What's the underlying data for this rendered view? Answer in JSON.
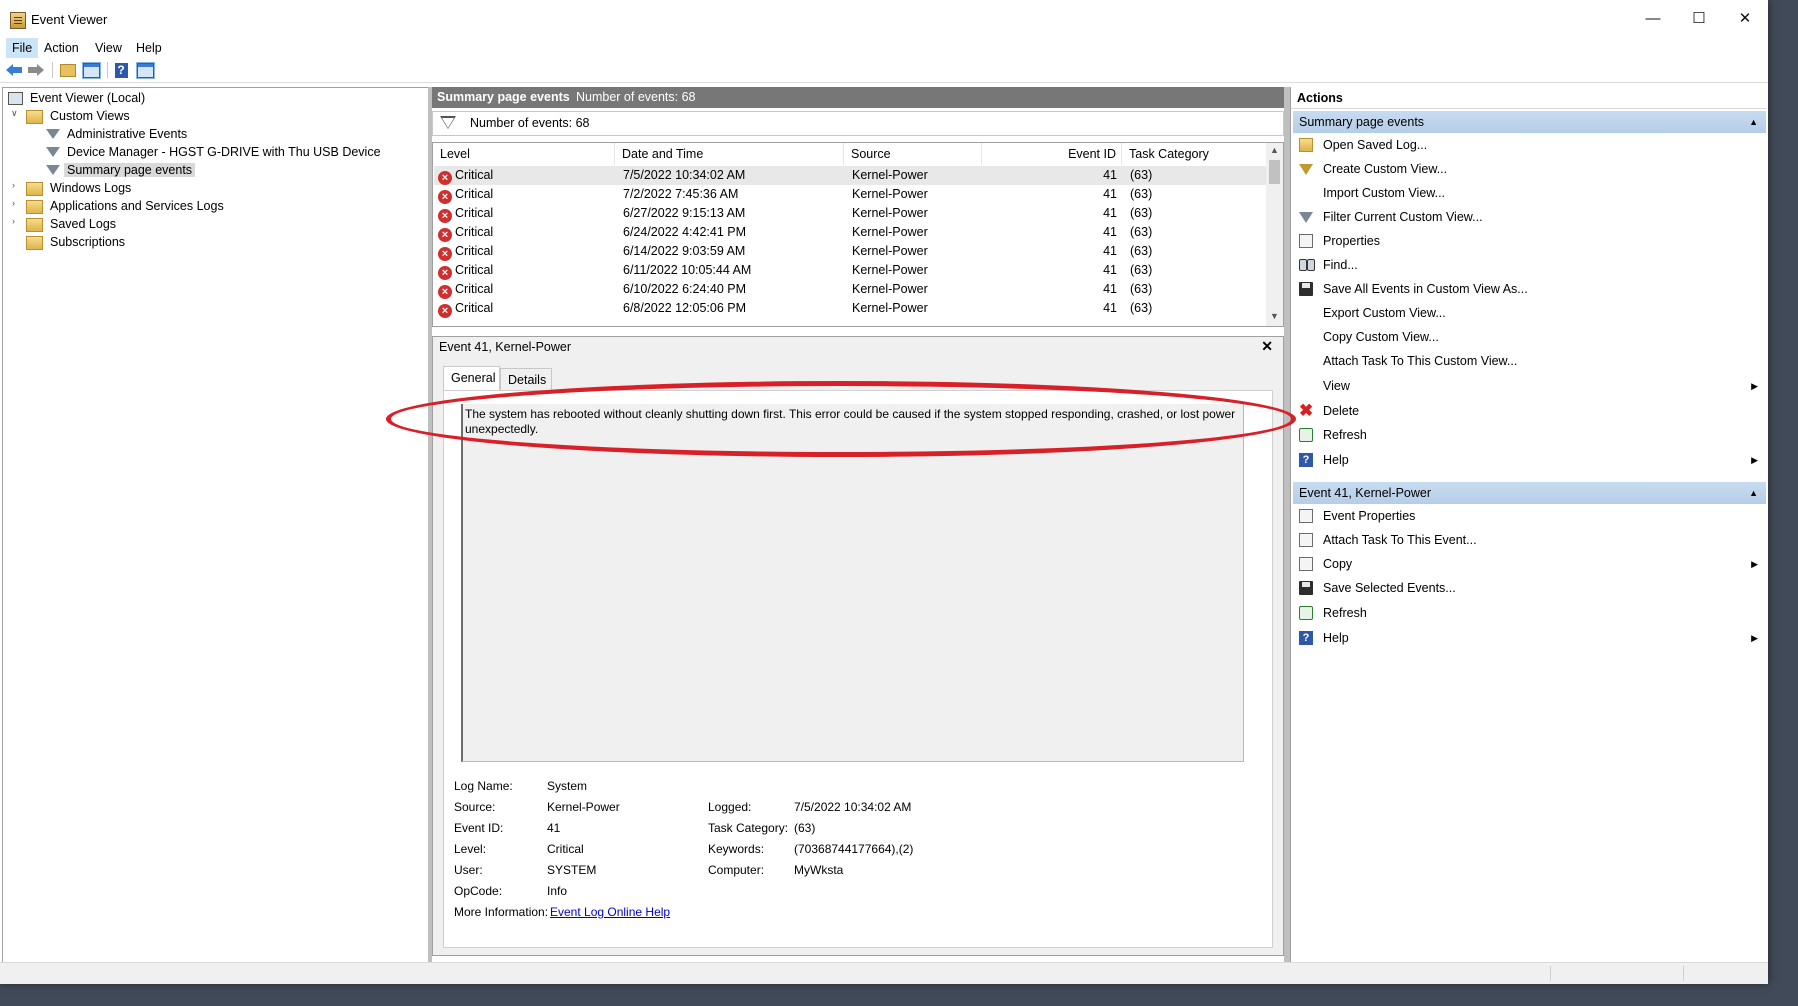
{
  "window": {
    "title": "Event Viewer"
  },
  "menu": [
    "File",
    "Action",
    "View",
    "Help"
  ],
  "tree": {
    "root": "Event Viewer (Local)",
    "custom_views": "Custom Views",
    "admin_events": "Administrative Events",
    "device_manager": "Device Manager - HGST G-DRIVE with Thu USB Device",
    "summary_page": "Summary page events",
    "windows_logs": "Windows Logs",
    "apps_services": "Applications and Services Logs",
    "saved_logs": "Saved Logs",
    "subscriptions": "Subscriptions"
  },
  "center": {
    "header_title": "Summary page events",
    "header_count": "Number of events: 68",
    "filter_text": "Number of events: 68",
    "columns": [
      "Level",
      "Date and Time",
      "Source",
      "Event ID",
      "Task Category"
    ],
    "rows": [
      {
        "level": "Critical",
        "date": "7/5/2022 10:34:02 AM",
        "source": "Kernel-Power",
        "id": "41",
        "task": "(63)"
      },
      {
        "level": "Critical",
        "date": "7/2/2022 7:45:36 AM",
        "source": "Kernel-Power",
        "id": "41",
        "task": "(63)"
      },
      {
        "level": "Critical",
        "date": "6/27/2022 9:15:13 AM",
        "source": "Kernel-Power",
        "id": "41",
        "task": "(63)"
      },
      {
        "level": "Critical",
        "date": "6/24/2022 4:42:41 PM",
        "source": "Kernel-Power",
        "id": "41",
        "task": "(63)"
      },
      {
        "level": "Critical",
        "date": "6/14/2022 9:03:59 AM",
        "source": "Kernel-Power",
        "id": "41",
        "task": "(63)"
      },
      {
        "level": "Critical",
        "date": "6/11/2022 10:05:44 AM",
        "source": "Kernel-Power",
        "id": "41",
        "task": "(63)"
      },
      {
        "level": "Critical",
        "date": "6/10/2022 6:24:40 PM",
        "source": "Kernel-Power",
        "id": "41",
        "task": "(63)"
      },
      {
        "level": "Critical",
        "date": "6/8/2022 12:05:06 PM",
        "source": "Kernel-Power",
        "id": "41",
        "task": "(63)"
      }
    ],
    "detail_title": "Event 41, Kernel-Power",
    "tabs": [
      "General",
      "Details"
    ],
    "description": "The system has rebooted without cleanly shutting down first. This error could be caused if the system stopped responding, crashed, or lost power unexpectedly.",
    "fields": {
      "log_name_label": "Log Name:",
      "log_name": "System",
      "source_label": "Source:",
      "source": "Kernel-Power",
      "logged_label": "Logged:",
      "logged": "7/5/2022 10:34:02 AM",
      "event_id_label": "Event ID:",
      "event_id": "41",
      "task_label": "Task Category:",
      "task": "(63)",
      "level_label": "Level:",
      "level": "Critical",
      "keywords_label": "Keywords:",
      "keywords": "(70368744177664),(2)",
      "user_label": "User:",
      "user": "SYSTEM",
      "computer_label": "Computer:",
      "computer": "MyWksta",
      "opcode_label": "OpCode:",
      "opcode": "Info",
      "more_info_label": "More Information:",
      "more_info_link": "Event Log Online Help"
    }
  },
  "actions": {
    "title": "Actions",
    "section1": "Summary page events",
    "items1": [
      "Open Saved Log...",
      "Create Custom View...",
      "Import Custom View...",
      "Filter Current Custom View...",
      "Properties",
      "Find...",
      "Save All Events in Custom View As...",
      "Export Custom View...",
      "Copy Custom View...",
      "Attach Task To This Custom View...",
      "View",
      "Delete",
      "Refresh",
      "Help"
    ],
    "section2": "Event 41, Kernel-Power",
    "items2": [
      "Event Properties",
      "Attach Task To This Event...",
      "Copy",
      "Save Selected Events...",
      "Refresh",
      "Help"
    ]
  },
  "colors": {
    "annotation": "#d72027",
    "section_header": "#c7dcf0",
    "critical": "#d12f2f",
    "pane_header": "#777777"
  }
}
